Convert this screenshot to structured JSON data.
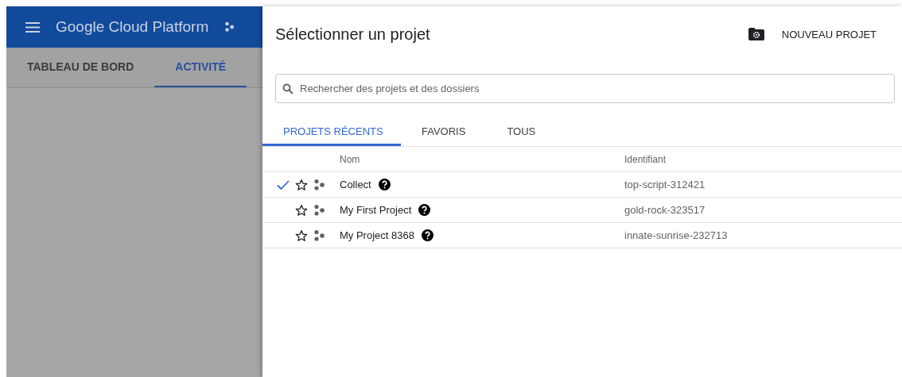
{
  "app_bar": {
    "title": "Google Cloud Platform"
  },
  "nav_tabs": [
    {
      "label": "TABLEAU DE BORD",
      "selected": false
    },
    {
      "label": "ACTIVITÉ",
      "selected": true
    }
  ],
  "dialog": {
    "title": "Sélectionner un projet",
    "new_project_button": "NOUVEAU PROJET",
    "search": {
      "placeholder": "Rechercher des projets et des dossiers"
    },
    "tabs": [
      {
        "label": "PROJETS RÉCENTS",
        "selected": true
      },
      {
        "label": "FAVORIS",
        "selected": false
      },
      {
        "label": "TOUS",
        "selected": false
      }
    ],
    "table": {
      "columns": [
        "Nom",
        "Identifiant"
      ],
      "rows": [
        {
          "current": true,
          "starred": false,
          "name": "Collect",
          "id": "top-script-312421"
        },
        {
          "current": false,
          "starred": false,
          "name": "My First Project",
          "id": "gold-rock-323517"
        },
        {
          "current": false,
          "starred": false,
          "name": "My Project 8368",
          "id": "innate-sunrise-232713"
        }
      ]
    }
  }
}
